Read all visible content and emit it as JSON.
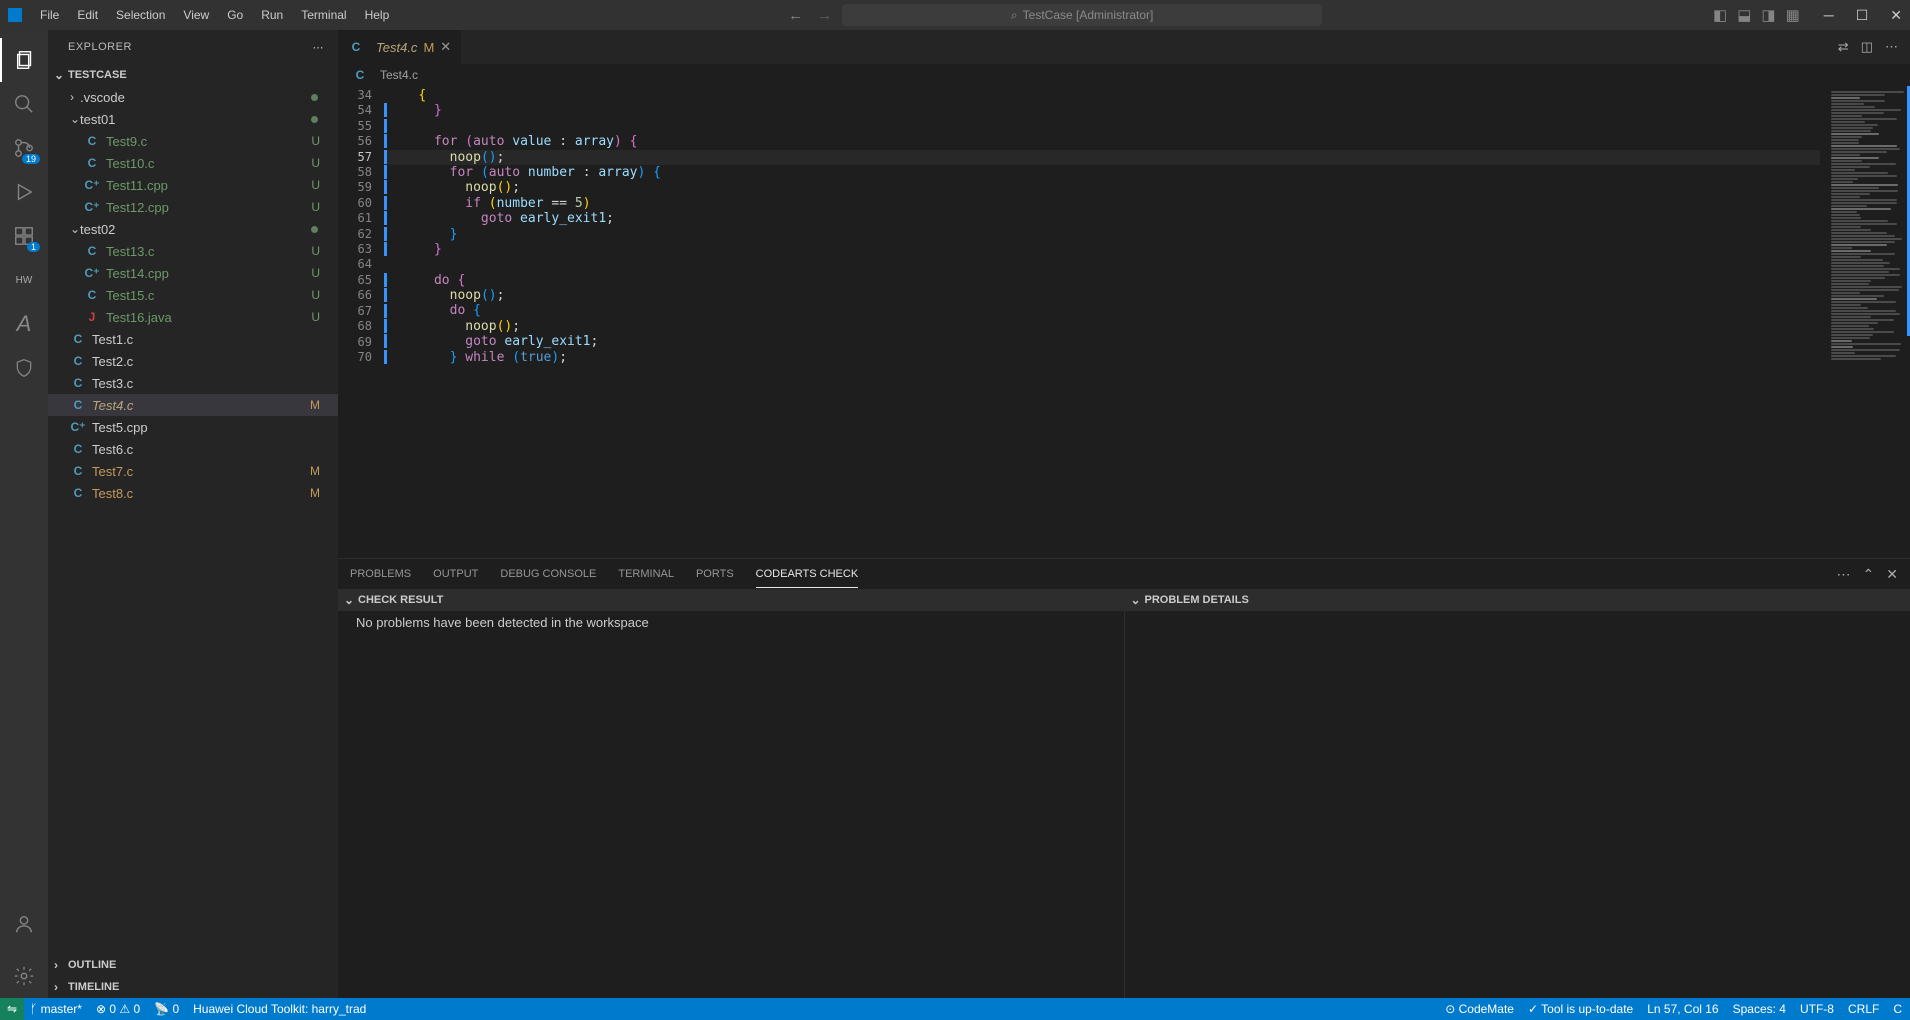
{
  "titlebar": {
    "menu": [
      "File",
      "Edit",
      "Selection",
      "View",
      "Go",
      "Run",
      "Terminal",
      "Help"
    ],
    "search_text": "TestCase [Administrator]"
  },
  "sidebar": {
    "title": "EXPLORER",
    "workspace": "TESTCASE",
    "tree": [
      {
        "indent": 1,
        "kind": "folder-closed",
        "label": ".vscode",
        "status": "dot"
      },
      {
        "indent": 1,
        "kind": "folder-open",
        "label": "test01",
        "status": "dot"
      },
      {
        "indent": 2,
        "kind": "c",
        "label": "Test9.c",
        "status": "U"
      },
      {
        "indent": 2,
        "kind": "c",
        "label": "Test10.c",
        "status": "U"
      },
      {
        "indent": 2,
        "kind": "cpp",
        "label": "Test11.cpp",
        "status": "U"
      },
      {
        "indent": 2,
        "kind": "cpp",
        "label": "Test12.cpp",
        "status": "U"
      },
      {
        "indent": 1,
        "kind": "folder-open",
        "label": "test02",
        "status": "dot"
      },
      {
        "indent": 2,
        "kind": "c",
        "label": "Test13.c",
        "status": "U"
      },
      {
        "indent": 2,
        "kind": "cpp",
        "label": "Test14.cpp",
        "status": "U"
      },
      {
        "indent": 2,
        "kind": "c",
        "label": "Test15.c",
        "status": "U"
      },
      {
        "indent": 2,
        "kind": "java",
        "label": "Test16.java",
        "status": "U"
      },
      {
        "indent": 1,
        "kind": "c",
        "label": "Test1.c",
        "status": ""
      },
      {
        "indent": 1,
        "kind": "c",
        "label": "Test2.c",
        "status": ""
      },
      {
        "indent": 1,
        "kind": "c",
        "label": "Test3.c",
        "status": ""
      },
      {
        "indent": 1,
        "kind": "c",
        "label": "Test4.c",
        "status": "M",
        "active": true,
        "italic": true
      },
      {
        "indent": 1,
        "kind": "cpp",
        "label": "Test5.cpp",
        "status": ""
      },
      {
        "indent": 1,
        "kind": "c",
        "label": "Test6.c",
        "status": ""
      },
      {
        "indent": 1,
        "kind": "c",
        "label": "Test7.c",
        "status": "M"
      },
      {
        "indent": 1,
        "kind": "c",
        "label": "Test8.c",
        "status": "M"
      }
    ],
    "outline": "OUTLINE",
    "timeline": "TIMELINE"
  },
  "editor": {
    "tab_label": "Test4.c",
    "tab_badge": "M",
    "breadcrumb": "Test4.c",
    "startLine": 34,
    "lines": [
      {
        "n": 34,
        "tokens": [
          {
            "t": "    ",
            "c": "pn"
          },
          {
            "t": "{",
            "c": "br1"
          }
        ]
      },
      {
        "n": 54,
        "tokens": [
          {
            "t": "      ",
            "c": "pn"
          },
          {
            "t": "}",
            "c": "br2"
          }
        ]
      },
      {
        "n": 55,
        "tokens": []
      },
      {
        "n": 56,
        "tokens": [
          {
            "t": "      ",
            "c": "pn"
          },
          {
            "t": "for",
            "c": "ctrl"
          },
          {
            "t": " ",
            "c": "pn"
          },
          {
            "t": "(",
            "c": "br2"
          },
          {
            "t": "auto",
            "c": "kw"
          },
          {
            "t": " value ",
            "c": "var"
          },
          {
            "t": ":",
            "c": "pn"
          },
          {
            "t": " array",
            "c": "var"
          },
          {
            "t": ")",
            "c": "br2"
          },
          {
            "t": " ",
            "c": "pn"
          },
          {
            "t": "{",
            "c": "br2"
          }
        ]
      },
      {
        "n": 57,
        "hl": true,
        "tokens": [
          {
            "t": "        ",
            "c": "pn"
          },
          {
            "t": "noop",
            "c": "fn"
          },
          {
            "t": "(",
            "c": "br3"
          },
          {
            "t": ")",
            "c": "br3"
          },
          {
            "t": ";",
            "c": "pn"
          }
        ]
      },
      {
        "n": 58,
        "tokens": [
          {
            "t": "        ",
            "c": "pn"
          },
          {
            "t": "for",
            "c": "ctrl"
          },
          {
            "t": " ",
            "c": "pn"
          },
          {
            "t": "(",
            "c": "br3"
          },
          {
            "t": "auto",
            "c": "kw"
          },
          {
            "t": " number ",
            "c": "var"
          },
          {
            "t": ":",
            "c": "pn"
          },
          {
            "t": " array",
            "c": "var"
          },
          {
            "t": ")",
            "c": "br3"
          },
          {
            "t": " ",
            "c": "pn"
          },
          {
            "t": "{",
            "c": "br3"
          }
        ]
      },
      {
        "n": 59,
        "tokens": [
          {
            "t": "          ",
            "c": "pn"
          },
          {
            "t": "noop",
            "c": "fn"
          },
          {
            "t": "(",
            "c": "br1"
          },
          {
            "t": ")",
            "c": "br1"
          },
          {
            "t": ";",
            "c": "pn"
          }
        ]
      },
      {
        "n": 60,
        "tokens": [
          {
            "t": "          ",
            "c": "pn"
          },
          {
            "t": "if",
            "c": "ctrl"
          },
          {
            "t": " ",
            "c": "pn"
          },
          {
            "t": "(",
            "c": "br1"
          },
          {
            "t": "number ",
            "c": "var"
          },
          {
            "t": "==",
            "c": "op"
          },
          {
            "t": " ",
            "c": "pn"
          },
          {
            "t": "5",
            "c": "num"
          },
          {
            "t": ")",
            "c": "br1"
          }
        ]
      },
      {
        "n": 61,
        "tokens": [
          {
            "t": "            ",
            "c": "pn"
          },
          {
            "t": "goto",
            "c": "ctrl"
          },
          {
            "t": " early_exit1",
            "c": "var"
          },
          {
            "t": ";",
            "c": "pn"
          }
        ]
      },
      {
        "n": 62,
        "tokens": [
          {
            "t": "        ",
            "c": "pn"
          },
          {
            "t": "}",
            "c": "br3"
          }
        ]
      },
      {
        "n": 63,
        "tokens": [
          {
            "t": "      ",
            "c": "pn"
          },
          {
            "t": "}",
            "c": "br2"
          }
        ]
      },
      {
        "n": 64,
        "tokens": []
      },
      {
        "n": 65,
        "tokens": [
          {
            "t": "      ",
            "c": "pn"
          },
          {
            "t": "do",
            "c": "ctrl"
          },
          {
            "t": " ",
            "c": "pn"
          },
          {
            "t": "{",
            "c": "br2"
          }
        ]
      },
      {
        "n": 66,
        "tokens": [
          {
            "t": "        ",
            "c": "pn"
          },
          {
            "t": "noop",
            "c": "fn"
          },
          {
            "t": "(",
            "c": "br3"
          },
          {
            "t": ")",
            "c": "br3"
          },
          {
            "t": ";",
            "c": "pn"
          }
        ]
      },
      {
        "n": 67,
        "tokens": [
          {
            "t": "        ",
            "c": "pn"
          },
          {
            "t": "do",
            "c": "ctrl"
          },
          {
            "t": " ",
            "c": "pn"
          },
          {
            "t": "{",
            "c": "br3"
          }
        ]
      },
      {
        "n": 68,
        "tokens": [
          {
            "t": "          ",
            "c": "pn"
          },
          {
            "t": "noop",
            "c": "fn"
          },
          {
            "t": "(",
            "c": "br1"
          },
          {
            "t": ")",
            "c": "br1"
          },
          {
            "t": ";",
            "c": "pn"
          }
        ]
      },
      {
        "n": 69,
        "tokens": [
          {
            "t": "          ",
            "c": "pn"
          },
          {
            "t": "goto",
            "c": "ctrl"
          },
          {
            "t": " early_exit1",
            "c": "var"
          },
          {
            "t": ";",
            "c": "pn"
          }
        ]
      },
      {
        "n": 70,
        "tokens": [
          {
            "t": "        ",
            "c": "pn"
          },
          {
            "t": "}",
            "c": "br3"
          },
          {
            "t": " ",
            "c": "pn"
          },
          {
            "t": "while",
            "c": "ctrl"
          },
          {
            "t": " ",
            "c": "pn"
          },
          {
            "t": "(",
            "c": "br3"
          },
          {
            "t": "true",
            "c": "const"
          },
          {
            "t": ")",
            "c": "br3"
          },
          {
            "t": ";",
            "c": "pn"
          }
        ]
      }
    ]
  },
  "panel": {
    "tabs": [
      "PROBLEMS",
      "OUTPUT",
      "DEBUG CONSOLE",
      "TERMINAL",
      "PORTS",
      "CODEARTS CHECK"
    ],
    "activeTab": 5,
    "check_result": "CHECK RESULT",
    "problem_details": "PROBLEM DETAILS",
    "no_problems": "No problems have been detected in the workspace"
  },
  "statusbar": {
    "branch": "master*",
    "errors": "0",
    "warnings": "0",
    "ports": "0",
    "toolkit": "Huawei Cloud Toolkit: harry_trad",
    "codemate": "CodeMate",
    "uptodate": "Tool is up-to-date",
    "cursor": "Ln 57, Col 16",
    "spaces": "Spaces: 4",
    "encoding": "UTF-8",
    "eol": "CRLF",
    "lang": "C"
  }
}
